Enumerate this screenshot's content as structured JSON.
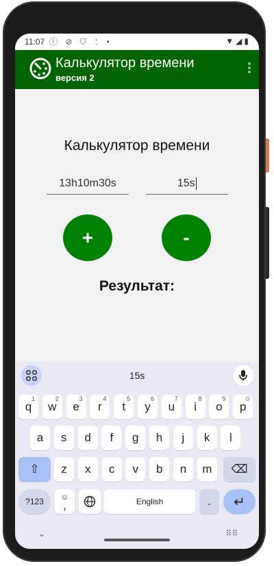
{
  "status": {
    "time": "11:07",
    "left_icons": "ⓘ ⊘ ⛉ ⍘ •",
    "right_icons": "▼◢▮"
  },
  "appbar": {
    "title": "Калькулятор времени",
    "subtitle": "версия 2",
    "color": "#006400"
  },
  "main": {
    "heading": "Калькулятор времени",
    "input1_value": "13h10m30s",
    "input2_value": "15s",
    "plus_label": "+",
    "minus_label": "-",
    "result_label": "Результат:",
    "button_color": "#008000"
  },
  "keyboard": {
    "suggestion": "15s",
    "row1": [
      {
        "k": "q",
        "n": "1"
      },
      {
        "k": "w",
        "n": "2"
      },
      {
        "k": "e",
        "n": "3"
      },
      {
        "k": "r",
        "n": "4"
      },
      {
        "k": "t",
        "n": "5"
      },
      {
        "k": "y",
        "n": "6"
      },
      {
        "k": "u",
        "n": "7"
      },
      {
        "k": "i",
        "n": "8"
      },
      {
        "k": "o",
        "n": "9"
      },
      {
        "k": "p",
        "n": "0"
      }
    ],
    "row2": [
      "a",
      "s",
      "d",
      "f",
      "g",
      "h",
      "j",
      "k",
      "l"
    ],
    "row3": [
      "z",
      "x",
      "c",
      "v",
      "b",
      "n",
      "m"
    ],
    "shift": "⇧",
    "backspace": "⌫",
    "symbols": "?123",
    "comma": ",",
    "emoji": "☺",
    "globe": "⊕",
    "space": "English",
    "period": ".",
    "enter": "↵",
    "hide": "⌄",
    "layout": "⠿⠿"
  }
}
